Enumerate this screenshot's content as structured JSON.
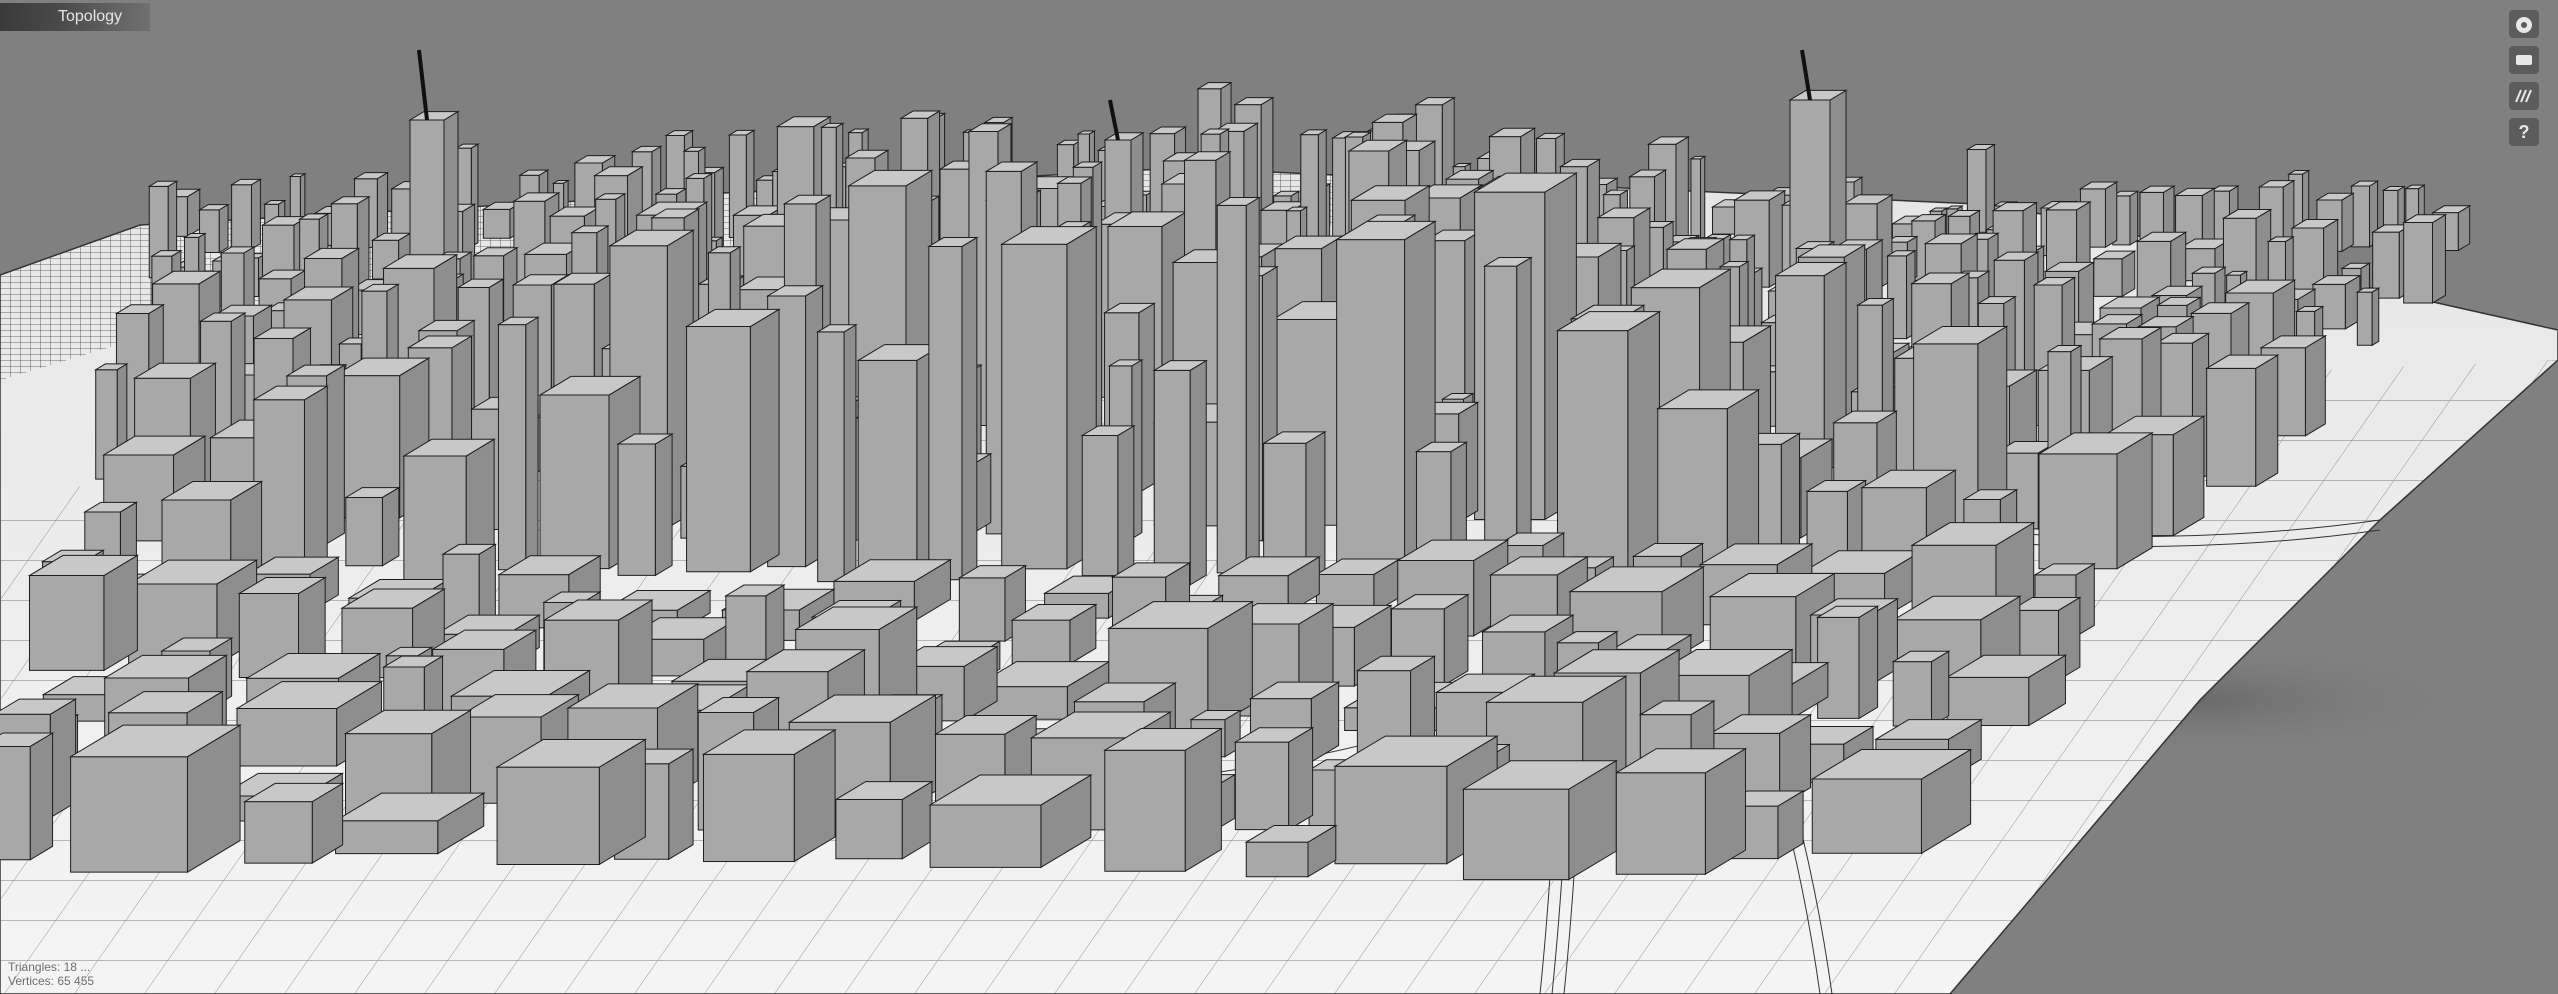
{
  "header": {
    "tab_title": "Topology"
  },
  "toolbar": {
    "buttons": [
      {
        "icon": "home-icon"
      },
      {
        "icon": "camera-icon"
      },
      {
        "icon": "layers-icon"
      },
      {
        "icon": "help-icon",
        "label": "?"
      }
    ]
  },
  "stats": {
    "triangles": "Triangles: 18 ...",
    "vertices": "Vertices: 65 455"
  }
}
